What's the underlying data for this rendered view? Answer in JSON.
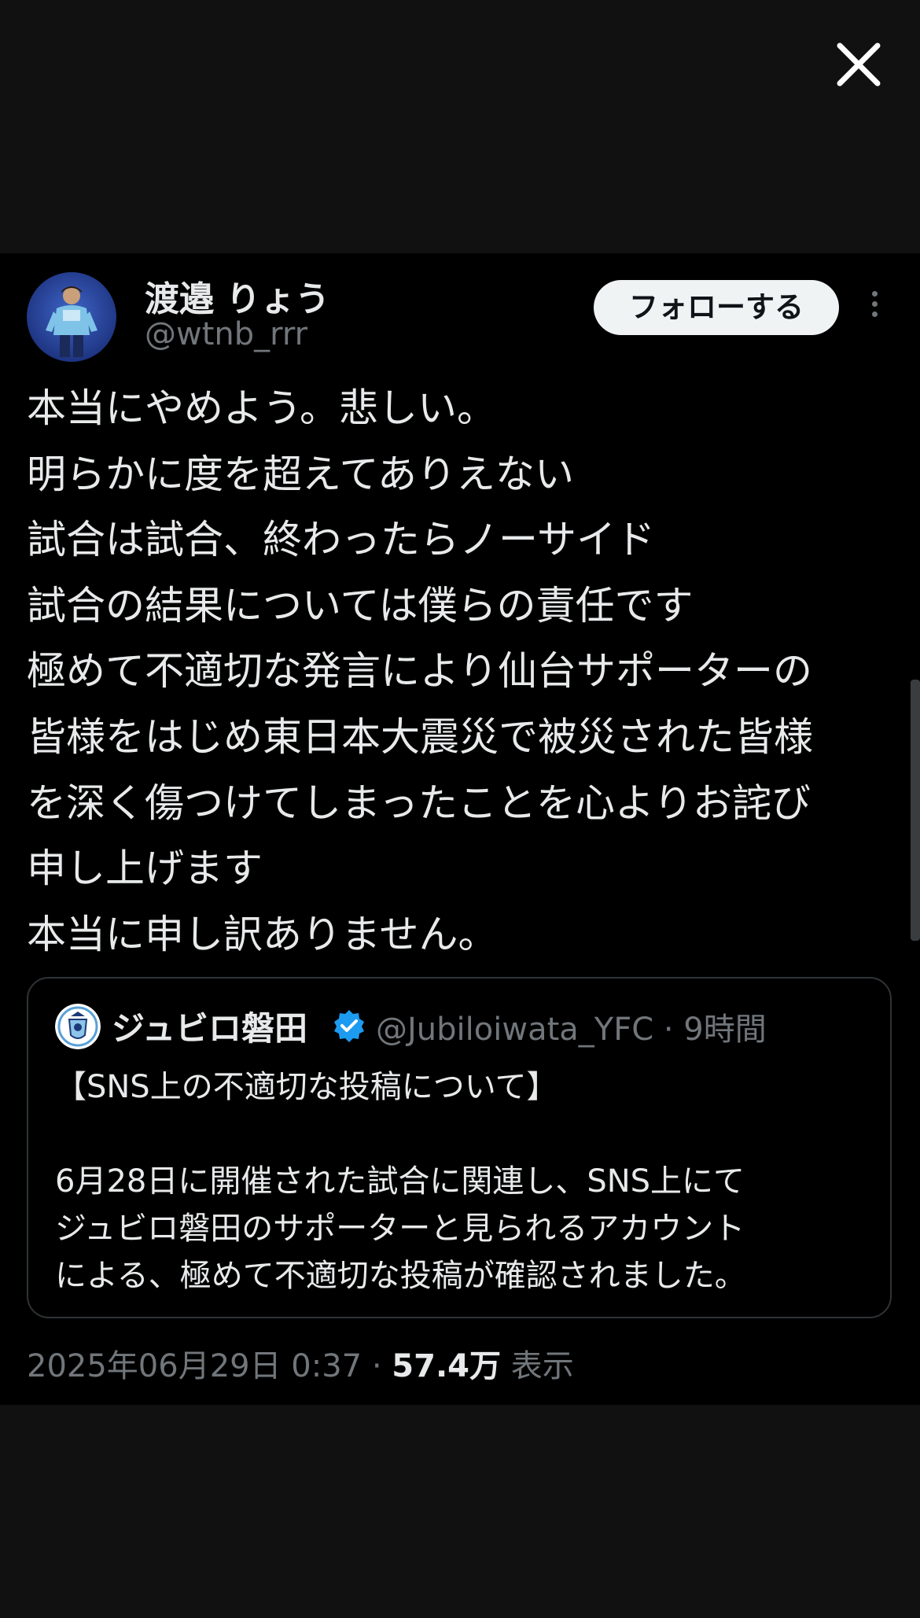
{
  "colors": {
    "background": "#111111",
    "tweet_background": "#000000",
    "text_primary": "#e7e9ea",
    "text_secondary": "#71767b",
    "verified_blue": "#1d9bf0",
    "follow_button_bg": "#eff3f4"
  },
  "viewer": {
    "close_icon": "close-icon"
  },
  "author": {
    "display_name": "渡邉 りょう",
    "handle": "@wtnb_rrr",
    "follow_label": "フォローする",
    "more_icon": "more-vertical-icon"
  },
  "post": {
    "lines": [
      "本当にやめよう。悲しい。",
      "明らかに度を超えてありえない",
      "試合は試合、終わったらノーサイド",
      "試合の結果については僕らの責任です",
      "極めて不適切な発言により仙台サポーターの",
      "皆様をはじめ東日本大震災で被災された皆様",
      "を深く傷つけてしまったことを心よりお詫び",
      "申し上げます",
      "本当に申し訳ありません。"
    ]
  },
  "quoted_post": {
    "display_name": "ジュビロ磐田",
    "verified_icon": "verified-badge-icon",
    "meta": "@Jubiloiwata_YFC · 9時間",
    "title": "【SNS上の不適切な投稿について】",
    "body_lines": [
      "6月28日に開催された試合に関連し、SNS上にて",
      "ジュビロ磐田のサポーターと見られるアカウント",
      "による、極めて不適切な投稿が確認されました。"
    ]
  },
  "footer": {
    "timestamp": "2025年06月29日 0:37 · ",
    "views_count": "57.4万",
    "views_label": " 表示"
  }
}
